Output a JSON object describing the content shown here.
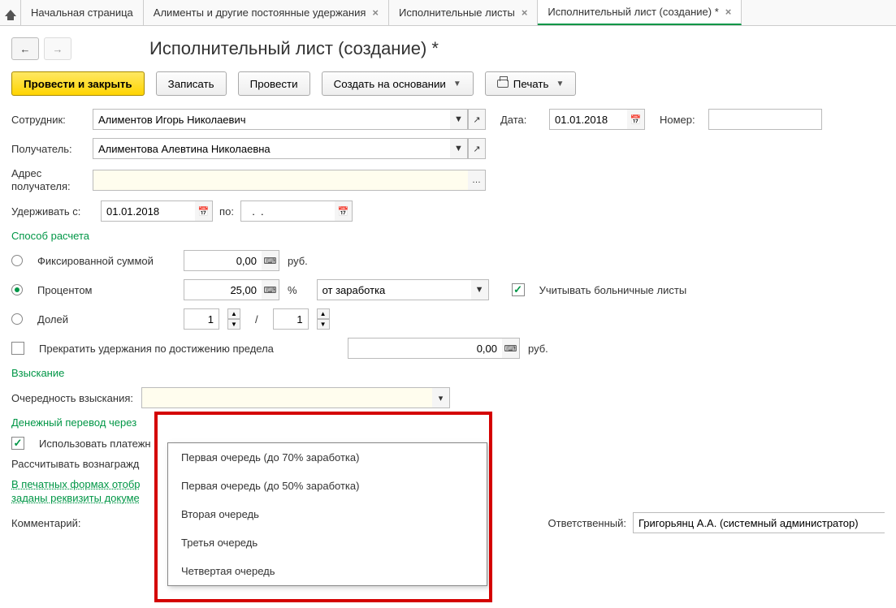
{
  "tabs": {
    "home": "Начальная страница",
    "t1": "Алименты и другие постоянные удержания",
    "t2": "Исполнительные листы",
    "t3": "Исполнительный лист (создание) *"
  },
  "title": "Исполнительный лист (создание) *",
  "buttons": {
    "post_close": "Провести и закрыть",
    "save": "Записать",
    "post": "Провести",
    "create_based": "Создать на основании",
    "print": "Печать"
  },
  "form": {
    "employee_lbl": "Сотрудник:",
    "employee_val": "Алиментов Игорь Николаевич",
    "date_lbl": "Дата:",
    "date_val": "01.01.2018",
    "number_lbl": "Номер:",
    "number_val": "",
    "recipient_lbl": "Получатель:",
    "recipient_val": "Алиментова Алевтина Николаевна",
    "address_lbl": "Адрес получателя:",
    "address_val": "",
    "withhold_from_lbl": "Удерживать с:",
    "withhold_from_val": "01.01.2018",
    "withhold_to_lbl": "по:",
    "withhold_to_val": "  .  .    "
  },
  "calc": {
    "section": "Способ расчета",
    "fixed_lbl": "Фиксированной суммой",
    "fixed_val": "0,00",
    "fixed_unit": "руб.",
    "percent_lbl": "Процентом",
    "percent_val": "25,00",
    "percent_unit": "%",
    "base_val": "от заработка",
    "sick_lbl": "Учитывать больничные листы",
    "fraction_lbl": "Долей",
    "fraction_num": "1",
    "fraction_den": "1",
    "fraction_sep": "/",
    "stop_lbl": "Прекратить удержания по достижению предела",
    "stop_val": "0,00",
    "stop_unit": "руб."
  },
  "collection": {
    "section": "Взыскание",
    "priority_lbl": "Очередность взыскания:",
    "priority_val": "",
    "options": [
      "Первая очередь (до 70% заработка)",
      "Первая очередь (до 50% заработка)",
      "Вторая очередь",
      "Третья очередь",
      "Четвертая очередь"
    ]
  },
  "transfer": {
    "section": "Денежный перевод через",
    "use_agent_lbl": "Использовать платежн",
    "calc_reward_lbl": "Рассчитывать вознагражд",
    "print_forms_link1": "В печатных формах отобр",
    "print_forms_link2": "заданы реквизиты докуме"
  },
  "footer": {
    "comment_lbl": "Комментарий:",
    "responsible_lbl": "Ответственный:",
    "responsible_val": "Григорьянц А.А. (системный администратор)"
  }
}
